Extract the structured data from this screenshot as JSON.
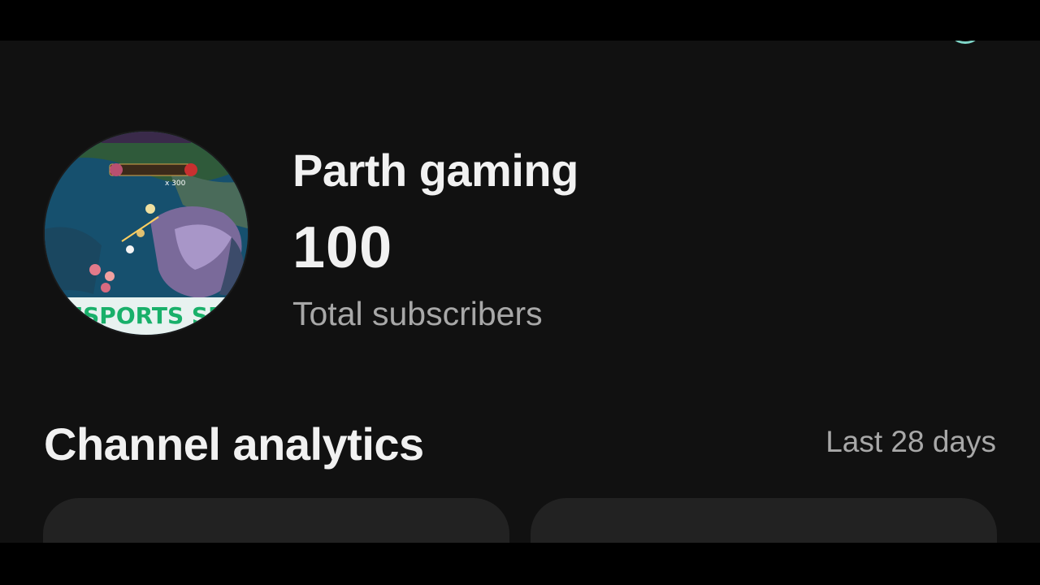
{
  "channel": {
    "name": "Parth gaming",
    "subscriber_count": "100",
    "subscriber_label": "Total subscribers",
    "avatar_banner_text": "ESPORTS SP",
    "avatar_overlay_value": "x 300"
  },
  "analytics": {
    "title": "Channel analytics",
    "period": "Last 28 days"
  },
  "colors": {
    "background": "#111111",
    "card": "#222222",
    "primary_text": "#f1f1f1",
    "secondary_text": "#a8a8a8"
  }
}
